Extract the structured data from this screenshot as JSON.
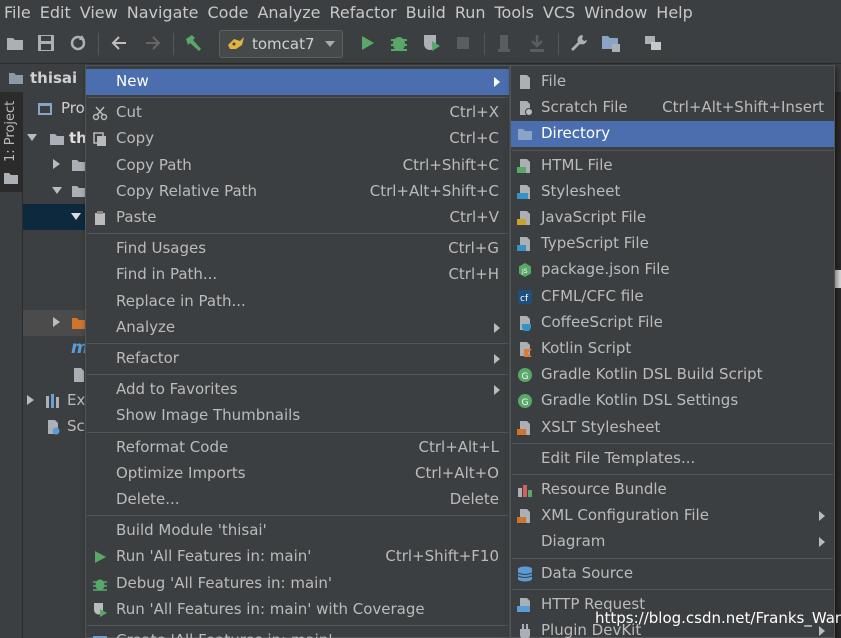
{
  "menubar": [
    "File",
    "Edit",
    "View",
    "Navigate",
    "Code",
    "Analyze",
    "Refactor",
    "Build",
    "Run",
    "Tools",
    "VCS",
    "Window",
    "Help"
  ],
  "toolbar": {
    "run_config": "tomcat7"
  },
  "navbar": {
    "project": "thisai"
  },
  "side_tab": "1: Project",
  "project_panel": {
    "header": "Pro",
    "root": "th",
    "rows": [
      "m",
      "Ex",
      "Sc"
    ]
  },
  "context_menu": [
    {
      "label": "New",
      "shortcut": "",
      "submenu": true,
      "highlighted": true
    },
    {
      "sep": true
    },
    {
      "label": "Cut",
      "shortcut": "Ctrl+X",
      "icon": "scissors-icon"
    },
    {
      "label": "Copy",
      "shortcut": "Ctrl+C",
      "icon": "copy-icon"
    },
    {
      "label": "Copy Path",
      "shortcut": "Ctrl+Shift+C"
    },
    {
      "label": "Copy Relative Path",
      "shortcut": "Ctrl+Alt+Shift+C"
    },
    {
      "label": "Paste",
      "shortcut": "Ctrl+V",
      "icon": "clipboard-icon"
    },
    {
      "sep": true
    },
    {
      "label": "Find Usages",
      "shortcut": "Ctrl+G"
    },
    {
      "label": "Find in Path...",
      "shortcut": "Ctrl+H"
    },
    {
      "label": "Replace in Path...",
      "shortcut": ""
    },
    {
      "label": "Analyze",
      "shortcut": "",
      "submenu": true
    },
    {
      "sep": true
    },
    {
      "label": "Refactor",
      "shortcut": "",
      "submenu": true
    },
    {
      "sep": true
    },
    {
      "label": "Add to Favorites",
      "shortcut": "",
      "submenu": true
    },
    {
      "label": "Show Image Thumbnails",
      "shortcut": ""
    },
    {
      "sep": true
    },
    {
      "label": "Reformat Code",
      "shortcut": "Ctrl+Alt+L"
    },
    {
      "label": "Optimize Imports",
      "shortcut": "Ctrl+Alt+O"
    },
    {
      "label": "Delete...",
      "shortcut": "Delete"
    },
    {
      "sep": true
    },
    {
      "label": "Build Module 'thisai'",
      "shortcut": ""
    },
    {
      "label": "Run 'All Features in: main'",
      "shortcut": "Ctrl+Shift+F10",
      "icon": "run-icon"
    },
    {
      "label": "Debug 'All Features in: main'",
      "shortcut": "",
      "icon": "debug-icon"
    },
    {
      "label": "Run 'All Features in: main' with Coverage",
      "shortcut": "",
      "icon": "coverage-icon"
    },
    {
      "sep": true
    },
    {
      "label": "Create 'All Features in: main'...",
      "shortcut": "",
      "icon": "create-config-icon"
    }
  ],
  "new_submenu": [
    {
      "label": "File",
      "shortcut": "",
      "icon": "file-icon"
    },
    {
      "label": "Scratch File",
      "shortcut": "Ctrl+Alt+Shift+Insert",
      "icon": "scratch-file-icon"
    },
    {
      "label": "Directory",
      "shortcut": "",
      "icon": "folder-icon",
      "highlighted": true
    },
    {
      "sep": true
    },
    {
      "label": "HTML File",
      "shortcut": "",
      "icon": "html-file-icon"
    },
    {
      "label": "Stylesheet",
      "shortcut": "",
      "icon": "css-file-icon"
    },
    {
      "label": "JavaScript File",
      "shortcut": "",
      "icon": "js-file-icon"
    },
    {
      "label": "TypeScript File",
      "shortcut": "",
      "icon": "ts-file-icon"
    },
    {
      "label": "package.json File",
      "shortcut": "",
      "icon": "nodejs-icon"
    },
    {
      "label": "CFML/CFC file",
      "shortcut": "",
      "icon": "cfml-icon"
    },
    {
      "label": "CoffeeScript File",
      "shortcut": "",
      "icon": "coffeescript-icon"
    },
    {
      "label": "Kotlin Script",
      "shortcut": "",
      "icon": "kotlin-icon"
    },
    {
      "label": "Gradle Kotlin DSL Build Script",
      "shortcut": "",
      "icon": "gradle-icon"
    },
    {
      "label": "Gradle Kotlin DSL Settings",
      "shortcut": "",
      "icon": "gradle-icon"
    },
    {
      "label": "XSLT Stylesheet",
      "shortcut": "",
      "icon": "xslt-icon"
    },
    {
      "sep": true
    },
    {
      "label": "Edit File Templates...",
      "shortcut": ""
    },
    {
      "sep": true
    },
    {
      "label": "Resource Bundle",
      "shortcut": "",
      "icon": "resource-bundle-icon"
    },
    {
      "label": "XML Configuration File",
      "shortcut": "",
      "icon": "xml-file-icon",
      "submenu": true
    },
    {
      "label": "Diagram",
      "shortcut": "",
      "submenu": true
    },
    {
      "sep": true
    },
    {
      "label": "Data Source",
      "shortcut": "",
      "icon": "database-icon"
    },
    {
      "sep": true
    },
    {
      "label": "HTTP Request",
      "shortcut": "",
      "icon": "api-icon"
    },
    {
      "label": "Plugin DevKit",
      "shortcut": "",
      "icon": "plugin-icon",
      "submenu": true
    }
  ],
  "watermark": "https://blog.csdn.net/Franks_Wan",
  "colors": {
    "highlight": "#4b6eaf",
    "panel": "#3c3f41",
    "editor": "#2b2b2b",
    "text": "#bbbbbb"
  }
}
